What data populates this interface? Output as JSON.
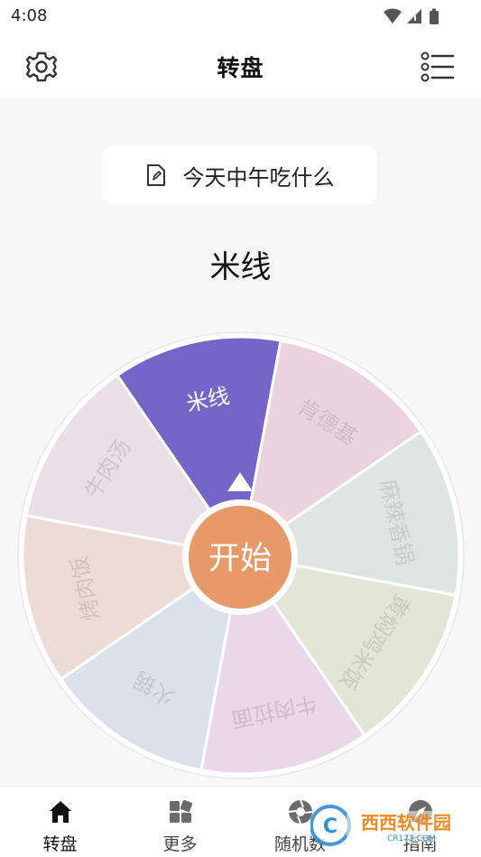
{
  "status_bar": {
    "time": "4:08"
  },
  "app": {
    "title": "转盘"
  },
  "question": {
    "text": "今天中午吃什么"
  },
  "result": {
    "text": "米线"
  },
  "wheel": {
    "segments": [
      {
        "label": "米线",
        "color": "#7565c9",
        "text_color": "#ffffff"
      },
      {
        "label": "肯德基",
        "color": "#ead2df",
        "text_color": "#cdbcc5"
      },
      {
        "label": "麻辣香锅",
        "color": "#dde6e3",
        "text_color": "#c4cdca"
      },
      {
        "label": "黄焖鸡米饭",
        "color": "#e3e6d6",
        "text_color": "#c8cbbc"
      },
      {
        "label": "牛肉拉面",
        "color": "#ead7ea",
        "text_color": "#cdbccd"
      },
      {
        "label": "火锅",
        "color": "#d9e2ea",
        "text_color": "#bfc7cf"
      },
      {
        "label": "烤肉饭",
        "color": "#eddbd5",
        "text_color": "#d2c1bb"
      },
      {
        "label": "牛肉汤",
        "color": "#eadfe5",
        "text_color": "#cfc4ca"
      }
    ],
    "start_label": "开始",
    "start_color": "#e8996a",
    "rim_color": "#ffffff"
  },
  "tabs": [
    {
      "label": "转盘",
      "icon": "home-icon",
      "active": true
    },
    {
      "label": "更多",
      "icon": "grid-icon",
      "active": false
    },
    {
      "label": "随机数",
      "icon": "aperture-icon",
      "active": false
    },
    {
      "label": "指南",
      "icon": "compass-icon",
      "active": false
    }
  ],
  "watermark": {
    "text": "西西软件园",
    "subtext": "CR173.COM"
  }
}
